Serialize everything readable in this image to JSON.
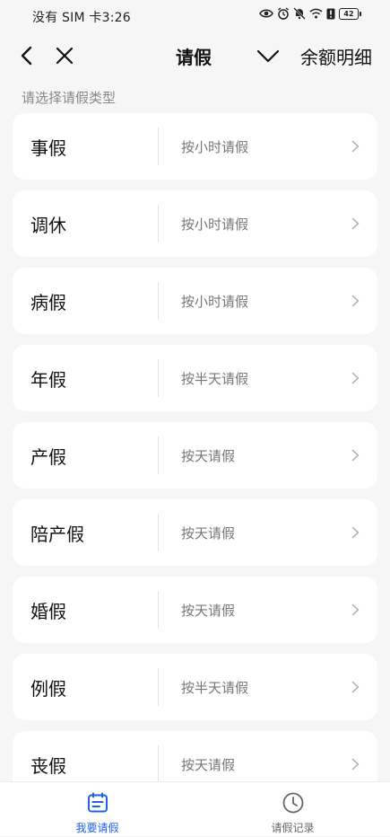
{
  "status_bar": {
    "carrier_time": "没有 SIM 卡3:26",
    "battery": "42",
    "icons": [
      "eye-icon",
      "alarm-icon",
      "mute-icon",
      "wifi-icon",
      "sim-alert-icon",
      "battery-icon"
    ]
  },
  "nav": {
    "back_icon": "chevron-left-icon",
    "close_icon": "close-icon",
    "title": "请假",
    "dropdown_icon": "chevron-down-icon",
    "balance_detail": "余额明细"
  },
  "section": {
    "label": "请选择请假类型"
  },
  "leave_types": [
    {
      "name": "事假",
      "mode": "按小时请假"
    },
    {
      "name": "调休",
      "mode": "按小时请假"
    },
    {
      "name": "病假",
      "mode": "按小时请假"
    },
    {
      "name": "年假",
      "mode": "按半天请假"
    },
    {
      "name": "产假",
      "mode": "按天请假"
    },
    {
      "name": "陪产假",
      "mode": "按天请假"
    },
    {
      "name": "婚假",
      "mode": "按天请假"
    },
    {
      "name": "例假",
      "mode": "按半天请假"
    },
    {
      "name": "丧假",
      "mode": "按天请假"
    }
  ],
  "tabs": [
    {
      "label": "我要请假",
      "icon": "calendar-form-icon",
      "active": true
    },
    {
      "label": "请假记录",
      "icon": "clock-icon",
      "active": false
    }
  ],
  "colors": {
    "accent": "#1f62e6",
    "background": "#f6f6f6",
    "card": "#ffffff"
  }
}
